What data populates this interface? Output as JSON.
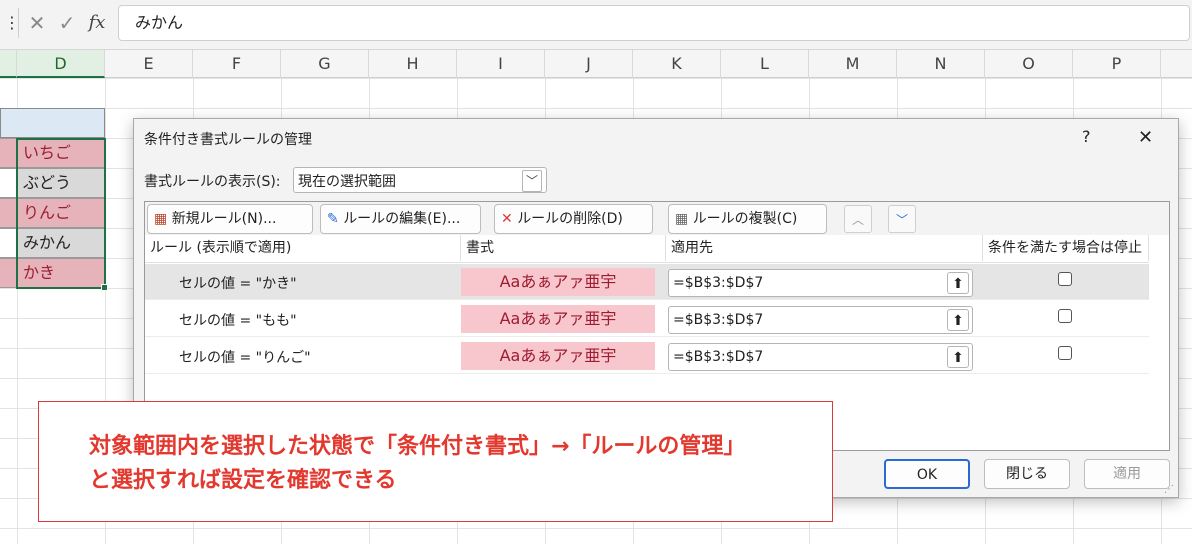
{
  "formula_bar": {
    "cancel_glyph": "✕",
    "enter_glyph": "✓",
    "fx_label": "fx",
    "value": "みかん"
  },
  "columns": [
    "D",
    "E",
    "F",
    "G",
    "H",
    "I",
    "J",
    "K",
    "L",
    "M",
    "N",
    "O",
    "P"
  ],
  "selected_column": "D",
  "cells": [
    "いちご",
    "ぶどう",
    "りんご",
    "みかん",
    "かき"
  ],
  "highlighted_cells": [
    true,
    false,
    true,
    false,
    true
  ],
  "colors": {
    "highlight_fill": "#e6b3bb",
    "highlight_text": "#9c1c30",
    "format_preview_fill": "#f8c6cd",
    "annotation_red": "#e3382e"
  },
  "dialog": {
    "title": "条件付き書式ルールの管理",
    "help_glyph": "?",
    "close_glyph": "✕",
    "show_rules_label": "書式ルールの表示(S):",
    "show_rules_value": "現在の選択範囲",
    "toolbar": {
      "new_rule": "新規ルール(N)...",
      "edit_rule": "ルールの編集(E)...",
      "delete_rule": "ルールの削除(D)",
      "duplicate_rule": "ルールの複製(C)"
    },
    "headers": {
      "rule": "ルール (表示順で適用)",
      "format": "書式",
      "applies_to": "適用先",
      "stop_if_true": "条件を満たす場合は停止"
    },
    "rules": [
      {
        "rule": "セルの値 = \"かき\"",
        "format": "Aaあぁアァ亜宇",
        "applies_to": "=$B$3:$D$7",
        "stop": false
      },
      {
        "rule": "セルの値 = \"もも\"",
        "format": "Aaあぁアァ亜宇",
        "applies_to": "=$B$3:$D$7",
        "stop": false
      },
      {
        "rule": "セルの値 = \"りんご\"",
        "format": "Aaあぁアァ亜宇",
        "applies_to": "=$B$3:$D$7",
        "stop": false
      }
    ],
    "ok_label": "OK",
    "close_label": "閉じる",
    "apply_label": "適用"
  },
  "annotation": {
    "line1": "対象範囲内を選択した状態で「条件付き書式」→「ルールの管理」",
    "line2": "と選択すれば設定を確認できる"
  }
}
